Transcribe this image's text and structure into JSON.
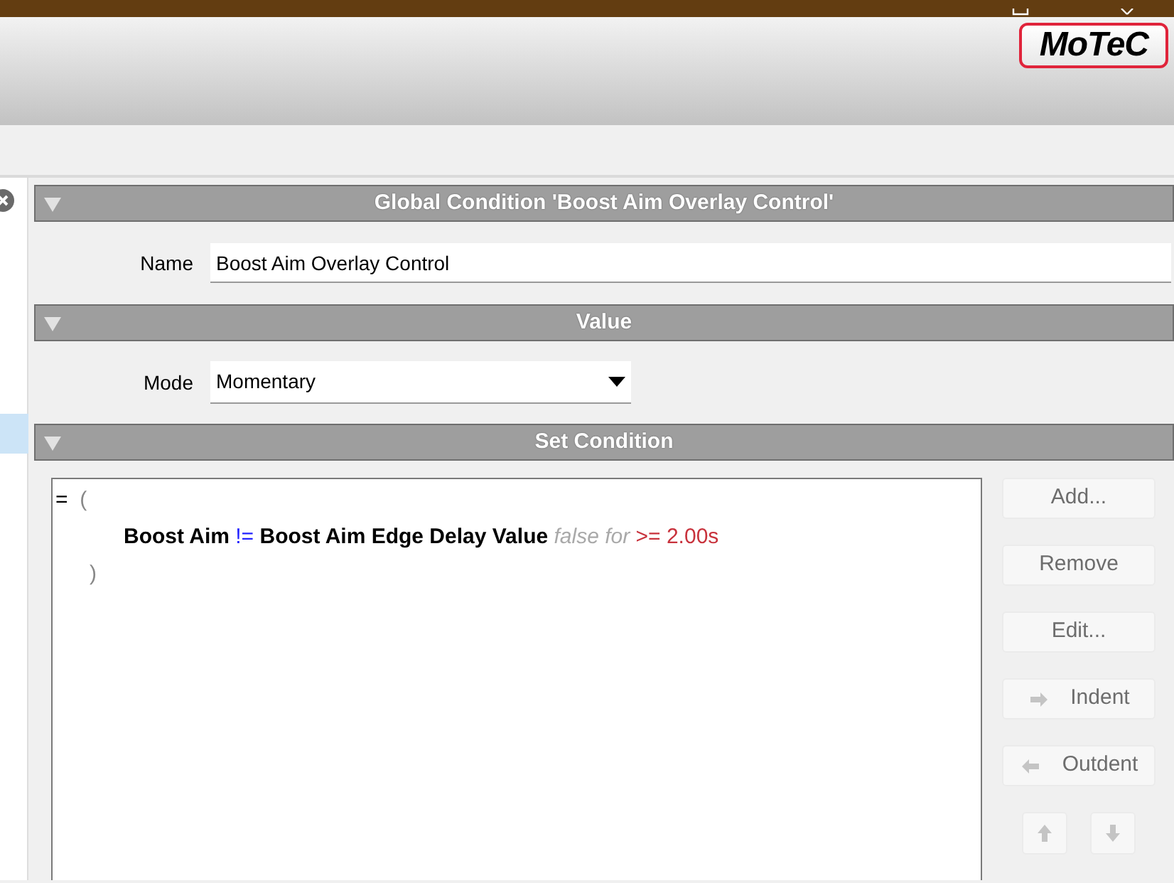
{
  "logo": "MoTeC",
  "sidebar": {
    "items": [
      {
        "selected": true
      }
    ]
  },
  "sections": [
    {
      "title": "Global Condition 'Boost Aim Overlay Control'",
      "expanded": true,
      "fields": [
        {
          "kind": "text",
          "label": "Name",
          "value": "Boost Aim Overlay Control"
        }
      ]
    },
    {
      "title": "Value",
      "expanded": true,
      "fields": [
        {
          "kind": "dropdown",
          "label": "Mode",
          "value": "Momentary"
        }
      ]
    },
    {
      "title": "Set Condition",
      "expanded": true,
      "expression": {
        "operator": "=",
        "open": "(",
        "children": [
          {
            "tokens": [
              {
                "kind": "signal",
                "text": "Boost Aim"
              },
              {
                "kind": "compare",
                "text": "!="
              },
              {
                "kind": "signal",
                "text": "Boost Aim Edge Delay Value"
              },
              {
                "kind": "qualifier",
                "text": "false for"
              },
              {
                "kind": "value",
                "text": ">= 2.00s"
              }
            ]
          }
        ],
        "close": ")"
      },
      "buttons": [
        {
          "kind": "text",
          "label": "Add...",
          "disabled": true
        },
        {
          "kind": "text",
          "label": "Remove",
          "disabled": true
        },
        {
          "kind": "text",
          "label": "Edit...",
          "disabled": true
        },
        {
          "kind": "indent",
          "label": "Indent",
          "disabled": true
        },
        {
          "kind": "outdent",
          "label": "Outdent",
          "disabled": true
        },
        {
          "kind": "move-up",
          "disabled": true
        },
        {
          "kind": "move-down",
          "disabled": true
        }
      ]
    }
  ]
}
